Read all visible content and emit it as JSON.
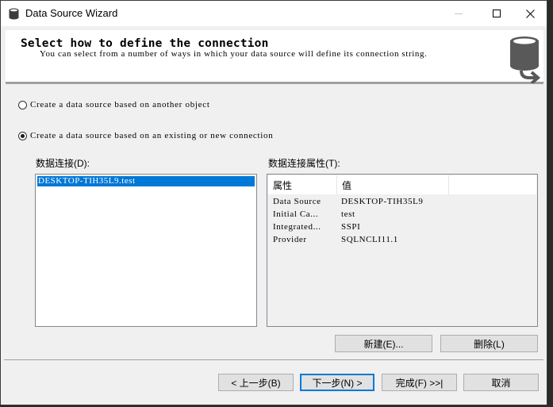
{
  "window": {
    "title": "Data Source Wizard",
    "icon": "database-icon",
    "controls": {
      "minimize": "minimize-icon",
      "maximize": "maximize-icon",
      "close": "close-icon"
    }
  },
  "header": {
    "title": "Select how to define the connection",
    "description": "You can select from a number of ways in which your data source will define its connection string.",
    "icon": "database-arrow-icon"
  },
  "options": [
    {
      "label": "Create a data source based on another object",
      "selected": false
    },
    {
      "label": "Create a data source based on an existing or new connection",
      "selected": true
    }
  ],
  "connections": {
    "label": "数据连接(D):",
    "items": [
      {
        "label": "DESKTOP-TIH35L9.test",
        "selected": true
      }
    ]
  },
  "properties": {
    "label": "数据连接属性(T):",
    "columns": [
      "属性",
      "值",
      ""
    ],
    "rows": [
      {
        "key": "Data Source",
        "value": "DESKTOP-TIH35L9"
      },
      {
        "key": "Initial Ca...",
        "value": "test"
      },
      {
        "key": "Integrated...",
        "value": "SSPI"
      },
      {
        "key": "Provider",
        "value": "SQLNCLI11.1"
      }
    ]
  },
  "buttons": {
    "new": "新建(E)...",
    "delete": "删除(L)",
    "back": "< 上一步(B)",
    "next": "下一步(N) >",
    "finish": "完成(F) >>|",
    "cancel": "取消"
  },
  "colors": {
    "accent": "#0078d7",
    "selection": "#0078d7",
    "icon": "#595959"
  }
}
